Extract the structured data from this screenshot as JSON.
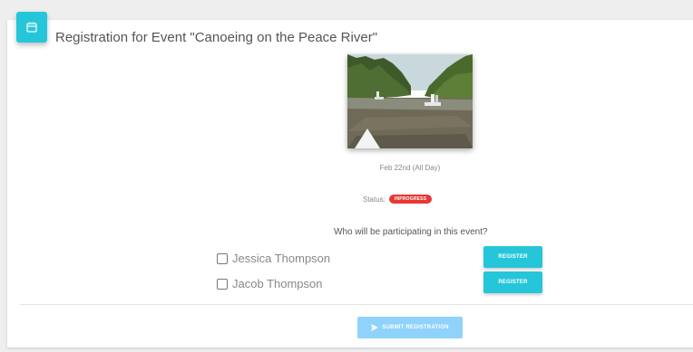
{
  "card": {
    "icon": "calendar-icon",
    "title": "Registration for Event \"Canoeing on the Peace River\""
  },
  "event": {
    "image": "canoeing-river-photo",
    "date": "Feb 22nd (All Day)",
    "status_label": "Status:",
    "status": "INPROGRESS"
  },
  "question": "Who will be participating in this event?",
  "participants": [
    {
      "name": "Jessica Thompson",
      "checked": false,
      "button_label": "REGISTER"
    },
    {
      "name": "Jacob Thompson",
      "checked": false,
      "button_label": "REGISTER"
    }
  ],
  "submit": {
    "icon": "send-icon",
    "label": "SUBMIT REGISTRATION"
  },
  "colors": {
    "accent": "#26c6da",
    "status_badge": "#e53935",
    "submit_disabled": "#8fd2fb"
  }
}
